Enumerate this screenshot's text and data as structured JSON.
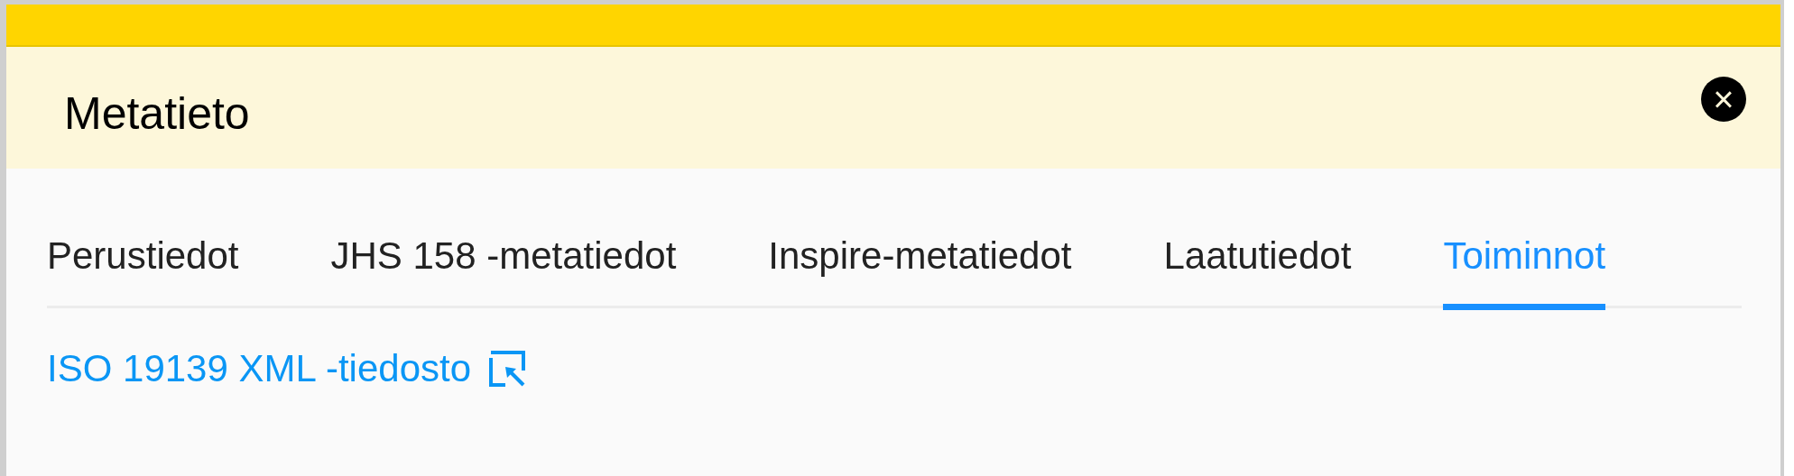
{
  "dialog": {
    "title": "Metatieto",
    "close_button": "×"
  },
  "tabs": [
    {
      "label": "Perustiedot",
      "selected": false
    },
    {
      "label": "JHS 158 -metatiedot",
      "selected": false
    },
    {
      "label": "Inspire-metatiedot",
      "selected": false
    },
    {
      "label": "Laatutiedot",
      "selected": false
    },
    {
      "label": "Toiminnot",
      "selected": true
    }
  ],
  "links": [
    {
      "label": "ISO 19139 XML -tiedosto"
    }
  ]
}
